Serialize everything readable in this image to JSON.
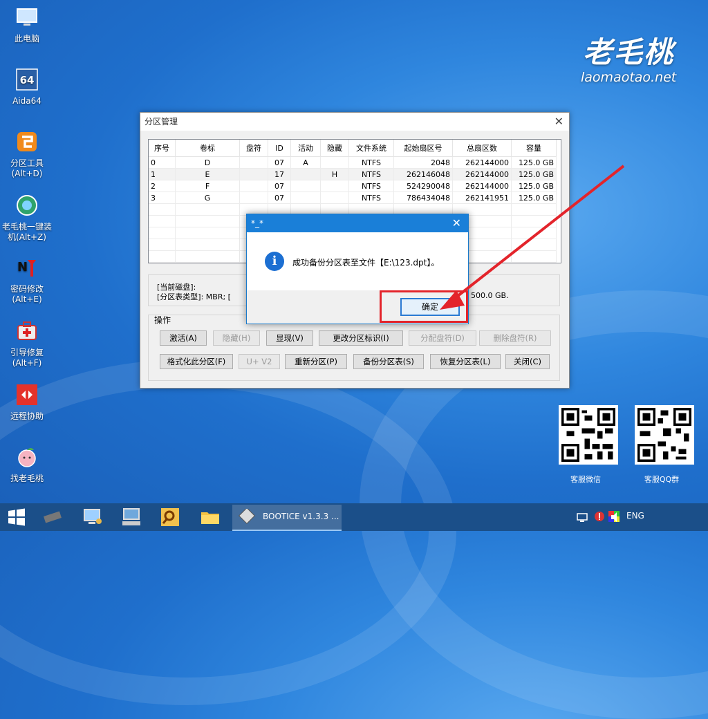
{
  "desktop": {
    "icons": [
      {
        "label": "此电脑",
        "icon": "computer-icon"
      },
      {
        "label": "Aida64",
        "icon": "aida64-icon"
      },
      {
        "label": "分区工具\n(Alt+D)",
        "icon": "partition-tool-icon"
      },
      {
        "label": "老毛桃一键装\n机(Alt+Z)",
        "icon": "installer-icon"
      },
      {
        "label": "密码修改\n(Alt+E)",
        "icon": "password-icon"
      },
      {
        "label": "引导修复\n(Alt+F)",
        "icon": "boot-repair-icon"
      },
      {
        "label": "远程协助",
        "icon": "remote-assist-icon"
      },
      {
        "label": "找老毛桃",
        "icon": "peach-icon"
      }
    ],
    "brand_cn": "老毛桃",
    "brand_en": "laomaotao.net",
    "qr": [
      {
        "caption": "客服微信"
      },
      {
        "caption": "客服QQ群"
      }
    ]
  },
  "window": {
    "title": "分区管理",
    "columns": [
      "序号",
      "卷标",
      "盘符",
      "ID",
      "活动",
      "隐藏",
      "文件系统",
      "起始扇区号",
      "总扇区数",
      "容量"
    ],
    "rows": [
      [
        "0",
        "D",
        "",
        "07",
        "A",
        "",
        "NTFS",
        "2048",
        "262144000",
        "125.0 GB"
      ],
      [
        "1",
        "E",
        "",
        "17",
        "",
        "H",
        "NTFS",
        "262146048",
        "262144000",
        "125.0 GB"
      ],
      [
        "2",
        "F",
        "",
        "07",
        "",
        "",
        "NTFS",
        "524290048",
        "262144000",
        "125.0 GB"
      ],
      [
        "3",
        "G",
        "",
        "07",
        "",
        "",
        "NTFS",
        "786434048",
        "262141951",
        "125.0 GB"
      ]
    ],
    "info_line1": "[当前磁盘]:",
    "info_line2_a": "[分区表类型]:    MBR;     [",
    "info_line2_b": "500.0 GB.",
    "ops_label": "操作",
    "buttons_row1": [
      {
        "label": "激活(A)",
        "enabled": true
      },
      {
        "label": "隐藏(H)",
        "enabled": false
      },
      {
        "label": "显现(V)",
        "enabled": true
      },
      {
        "label": "更改分区标识(I)",
        "enabled": true
      },
      {
        "label": "分配盘符(D)",
        "enabled": false
      },
      {
        "label": "删除盘符(R)",
        "enabled": false
      }
    ],
    "buttons_row2": [
      {
        "label": "格式化此分区(F)",
        "enabled": true
      },
      {
        "label": "U+ V2",
        "enabled": false
      },
      {
        "label": "重新分区(P)",
        "enabled": true
      },
      {
        "label": "备份分区表(S)",
        "enabled": true
      },
      {
        "label": "恢复分区表(L)",
        "enabled": true
      },
      {
        "label": "关闭(C)",
        "enabled": true
      }
    ]
  },
  "messagebox": {
    "title": "*_*",
    "text": "成功备份分区表至文件【E:\\123.dpt】。",
    "ok_label": "确定",
    "icon": "info-icon"
  },
  "taskbar": {
    "active_app": "BOOTICE v1.3.3 ...",
    "lang": "ENG"
  },
  "colors": {
    "accent": "#1a7fd8",
    "annotation": "#e3242b",
    "taskbar": "#1b4f89"
  }
}
